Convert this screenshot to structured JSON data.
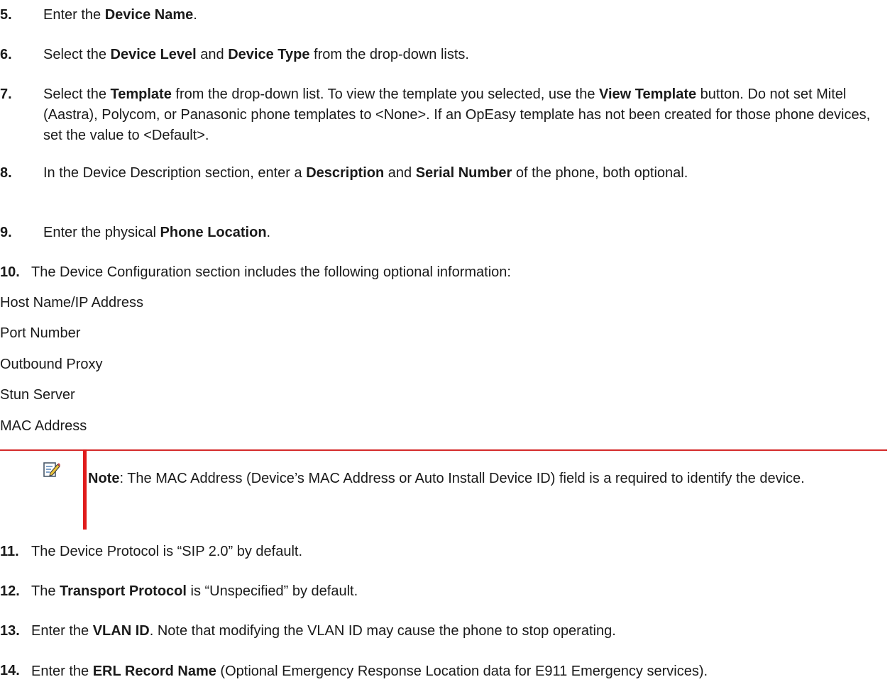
{
  "steps": [
    {
      "num": "5.",
      "parts": [
        [
          "t",
          "Enter the "
        ],
        [
          "b",
          "Device Name"
        ],
        [
          "t",
          "."
        ]
      ]
    },
    {
      "num": "6.",
      "parts": [
        [
          "t",
          "Select the "
        ],
        [
          "b",
          "Device Level"
        ],
        [
          "t",
          " and "
        ],
        [
          "b",
          "Device Type"
        ],
        [
          "t",
          " from the drop-down lists."
        ]
      ]
    },
    {
      "num": "7.",
      "parts": [
        [
          "t",
          "Select the "
        ],
        [
          "b",
          "Template"
        ],
        [
          "t",
          " from the drop-down list.  To view the template you selected, use the "
        ],
        [
          "b",
          "View Template"
        ],
        [
          "t",
          " button. Do not set Mitel (Aastra), Polycom, or Panasonic phone templates to <None>. If an OpEasy template has not been created for those phone devices, set the value to <Default>."
        ]
      ]
    },
    {
      "num": "8.",
      "parts": [
        [
          "t",
          "In the Device Description section, enter a "
        ],
        [
          "b",
          "Description"
        ],
        [
          "t",
          " and "
        ],
        [
          "b",
          "Serial Number"
        ],
        [
          "t",
          " of the phone, both optional."
        ]
      ]
    },
    {
      "num": "9.",
      "parts": [
        [
          "t",
          "Enter the physical "
        ],
        [
          "b",
          "Phone Location"
        ],
        [
          "t",
          "."
        ]
      ]
    },
    {
      "num": "10.",
      "parts": [
        [
          "t",
          "The Device Configuration section includes the following optional information:"
        ]
      ]
    },
    {
      "num": "11.",
      "parts": [
        [
          "t",
          "The Device Protocol is “SIP 2.0” by default."
        ]
      ]
    },
    {
      "num": "12.",
      "parts": [
        [
          "t",
          "The "
        ],
        [
          "b",
          "Transport Protocol"
        ],
        [
          "t",
          " is “Unspecified” by default."
        ]
      ]
    },
    {
      "num": "13.",
      "parts": [
        [
          "t",
          "Enter the "
        ],
        [
          "b",
          "VLAN ID"
        ],
        [
          "t",
          ". Note that modifying the VLAN ID may cause the phone to stop operating."
        ]
      ]
    },
    {
      "num": "14.",
      "parts": [
        [
          "t",
          "Enter the "
        ],
        [
          "b",
          "ERL Record Name"
        ],
        [
          "t",
          " (Optional Emergency Response Location data for E911 Emergency services)."
        ]
      ]
    }
  ],
  "config_items": [
    "Host Name/IP Address",
    "Port Number",
    "Outbound Proxy",
    "Stun Server",
    "MAC Address"
  ],
  "note": {
    "label": "Note",
    "text": ":   The MAC Address (Device’s MAC Address or Auto Install Device ID) field is a required to identify the device.",
    "icon": "note-pencil-icon"
  },
  "colors": {
    "accent_red": "#e01b1b",
    "text": "#1a1a1a"
  }
}
